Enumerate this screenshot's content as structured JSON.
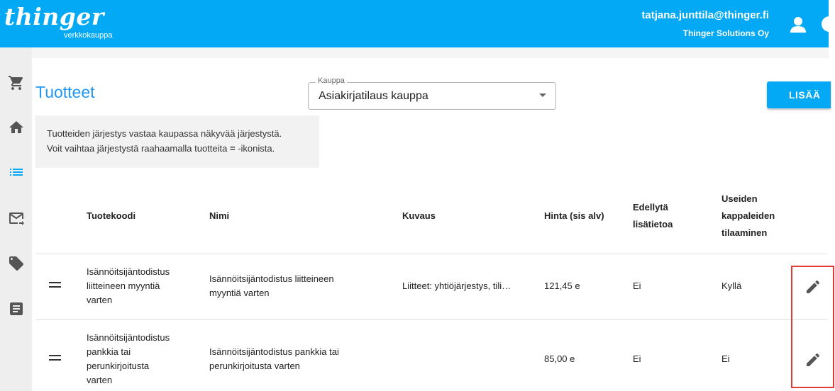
{
  "header": {
    "logo_main": "thinger",
    "logo_sub": "verkkokauppa",
    "user_email": "tatjana.junttila@thinger.fi",
    "user_org": "Thinger Solutions Oy",
    "account_icon": "account-icon",
    "bar_color": "#03a9f4"
  },
  "sidebar": {
    "items": [
      {
        "icon": "cart-icon"
      },
      {
        "icon": "home-icon"
      },
      {
        "icon": "list-icon",
        "active": true
      },
      {
        "icon": "mail-forward-icon"
      },
      {
        "icon": "tag-icon"
      },
      {
        "icon": "document-icon"
      }
    ]
  },
  "page": {
    "title": "Tuotteet",
    "shop_select_label": "Kauppa",
    "shop_select_value": "Asiakirjatilaus kauppa",
    "add_button": "LISÄÄ",
    "info_line1": "Tuotteiden järjestys vastaa kaupassa näkyvää järjestystä.",
    "info_line2_prefix": "Voit vaihtaa järjestystä raahaamalla tuotteita ",
    "info_line2_symbol": "=",
    "info_line2_suffix": " -ikonista."
  },
  "table": {
    "headers": {
      "code": "Tuotekoodi",
      "name": "Nimi",
      "description": "Kuvaus",
      "price": "Hinta (sis alv)",
      "requires_info": [
        "Edellytä",
        "lisätietoa"
      ],
      "multi_order": [
        "Useiden",
        "kappaleiden",
        "tilaaminen"
      ]
    },
    "rows": [
      {
        "code": [
          "Isännöitsijäntodistus",
          "liitteineen myyntiä",
          "varten"
        ],
        "name": [
          "Isännöitsijäntodistus liitteineen",
          "myyntiä varten"
        ],
        "description": "Liitteet: yhtiöjärjestys, tili…",
        "price": "121,45 e",
        "requires_info": "Ei",
        "multi_order": "Kyllä"
      },
      {
        "code": [
          "Isännöitsijäntodistus",
          "pankkia tai",
          "perunkirjoitusta",
          "varten"
        ],
        "name": [
          "Isännöitsijäntodistus pankkia tai",
          "perunkirjoitusta varten"
        ],
        "description": "",
        "price": "85,00 e",
        "requires_info": "Ei",
        "multi_order": "Ei"
      }
    ]
  },
  "colors": {
    "accent": "#03a9f4",
    "title": "#2196f3",
    "highlight": "#e53935"
  }
}
